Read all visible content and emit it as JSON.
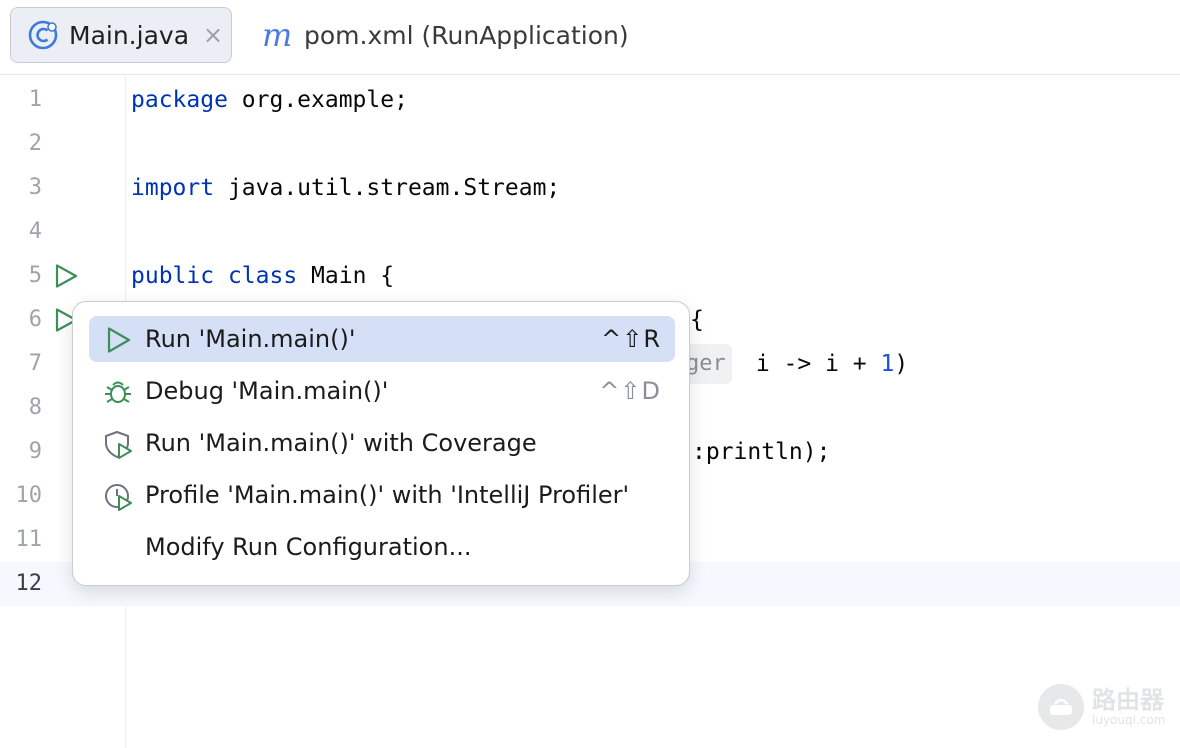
{
  "tabs": [
    {
      "label": "Main.java",
      "active": true,
      "icon": "java-class-icon"
    },
    {
      "label": "pom.xml (RunApplication)",
      "active": false,
      "icon": "maven-icon"
    }
  ],
  "tab_icon_glyph": "m",
  "tab_close_glyph": "×",
  "editor": {
    "line_numbers": [
      "1",
      "2",
      "3",
      "4",
      "5",
      "6",
      "7",
      "8",
      "9",
      "10",
      "11",
      "12"
    ],
    "current_line": "12",
    "code": {
      "l1_kw": "package",
      "l1_rest": " org.example;",
      "l3_kw": "import",
      "l3_rest": " java.util.stream.Stream;",
      "l5_kw1": "public",
      "l5_kw2": "class",
      "l5_rest": " Main {",
      "l6_visible": "{",
      "l7_hint": "ger",
      "l7_rest": " i -> i + ",
      "l7_num": "1",
      "l7_end": ")",
      "l9_visible": ":println);"
    }
  },
  "popup": {
    "items": [
      {
        "label": "Run 'Main.main()'",
        "shortcut": "^⇧R",
        "icon": "run-icon",
        "selected": true
      },
      {
        "label": "Debug 'Main.main()'",
        "shortcut": "^⇧D",
        "icon": "debug-icon",
        "selected": false
      },
      {
        "label": "Run 'Main.main()' with Coverage",
        "shortcut": "",
        "icon": "coverage-icon",
        "selected": false
      },
      {
        "label": "Profile 'Main.main()' with 'IntelliJ Profiler'",
        "shortcut": "",
        "icon": "profiler-icon",
        "selected": false
      },
      {
        "label": "Modify Run Configuration...",
        "shortcut": "",
        "icon": "",
        "selected": false
      }
    ]
  },
  "watermark": {
    "cn": "路由器",
    "en": "luyouqi.com"
  },
  "colors": {
    "keyword": "#0033b3",
    "number": "#1750eb",
    "run_green": "#3d8f58",
    "selection": "#d5e0f7"
  }
}
